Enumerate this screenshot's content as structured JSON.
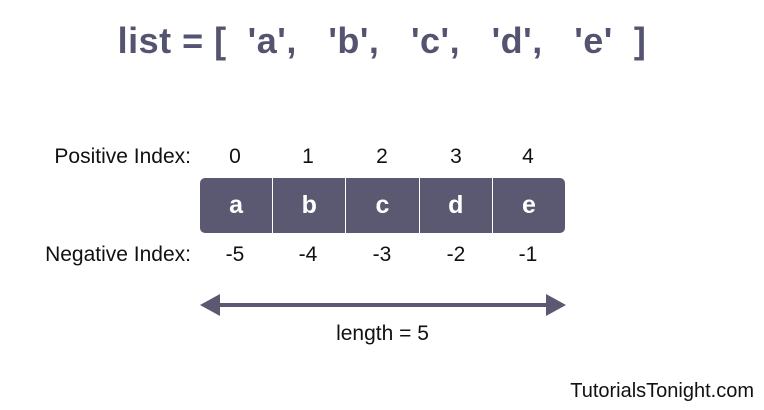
{
  "title": "list = [  'a',   'b',   'c',   'd',   'e'  ]",
  "positive": {
    "label": "Positive Index:",
    "values": [
      "0",
      "1",
      "2",
      "3",
      "4"
    ]
  },
  "elements": [
    "a",
    "b",
    "c",
    "d",
    "e"
  ],
  "negative": {
    "label": "Negative Index:",
    "values": [
      "-5",
      "-4",
      "-3",
      "-2",
      "-1"
    ]
  },
  "length": {
    "label": "length = 5"
  },
  "watermark": "TutorialsTonight.com",
  "colors": {
    "cell_fill": "#5b5872",
    "title_color": "#545470",
    "arrow_color": "#5b5872"
  }
}
